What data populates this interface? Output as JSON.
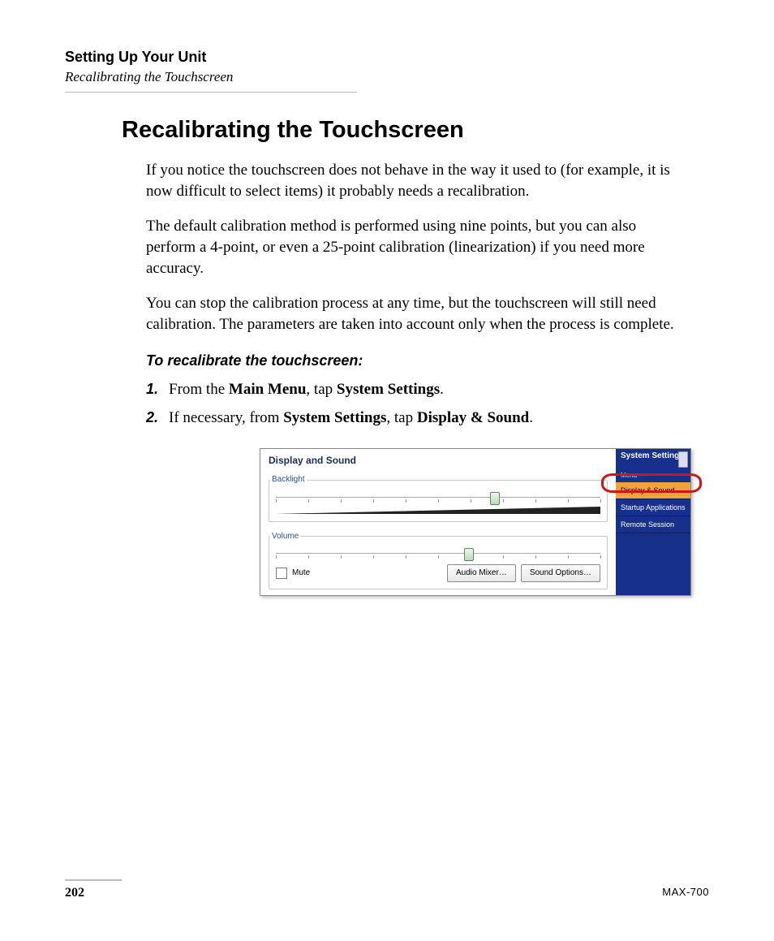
{
  "header": {
    "chapter": "Setting Up Your Unit",
    "section": "Recalibrating the Touchscreen"
  },
  "heading": "Recalibrating the Touchscreen",
  "paragraphs": {
    "p1": "If you notice the touchscreen does not behave in the way it used to (for example, it is now difficult to select items) it probably needs a recalibration.",
    "p2": "The default calibration method is performed using nine points, but you can also perform a 4-point, or even a 25-point calibration (linearization) if you need more accuracy.",
    "p3": "You can stop the calibration process at any time, but the touchscreen will still need calibration. The parameters are taken into account only when the process is complete."
  },
  "subhead": "To recalibrate the touchscreen:",
  "steps": {
    "s1": {
      "num": "1.",
      "pre": "From the ",
      "b1": "Main Menu",
      "mid": ", tap ",
      "b2": "System Settings",
      "post": "."
    },
    "s2": {
      "num": "2.",
      "pre": "If necessary, from ",
      "b1": "System Settings",
      "mid": ", tap ",
      "b2": "Display & Sound",
      "post": "."
    }
  },
  "screenshot": {
    "panel_title": "Display and Sound",
    "group1": "Backlight",
    "group2": "Volume",
    "mute": "Mute",
    "btn_audio_mixer": "Audio Mixer…",
    "btn_sound_options": "Sound Options…",
    "side_title": "System Settings",
    "side_menu_label": "Menu",
    "side_items": {
      "i1": "Display & Sound",
      "i2": "Startup Applications",
      "i3": "Remote Session"
    }
  },
  "footer": {
    "page": "202",
    "model": "MAX-700"
  }
}
